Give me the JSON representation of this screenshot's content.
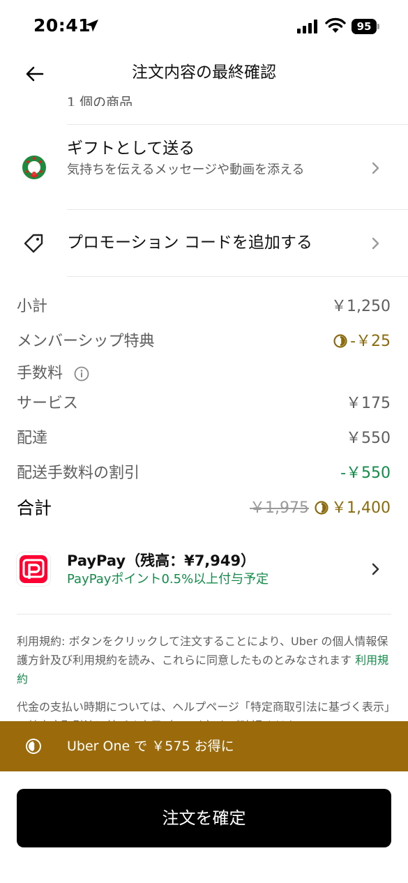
{
  "status_bar": {
    "time": "20:41",
    "battery": "95"
  },
  "header": {
    "title": "注文内容の最終確認"
  },
  "clipped_item": "1 個の商品",
  "gift": {
    "title": "ギフトとして送る",
    "subtitle": "気持ちを伝えるメッセージや動画を添える"
  },
  "promo": {
    "title": "プロモーション コードを追加する"
  },
  "prices": {
    "subtotal_label": "小計",
    "subtotal_value": "￥1,250",
    "membership_label": "メンバーシップ特典",
    "membership_value": "-￥25",
    "fees_label": "手数料",
    "service_label": "サービス",
    "service_value": "￥175",
    "delivery_label": "配達",
    "delivery_value": "￥550",
    "delivery_discount_label": "配送手数料の割引",
    "delivery_discount_value": "-￥550",
    "total_label": "合計",
    "total_original": "￥1,975",
    "total_value": "￥1,400"
  },
  "payment": {
    "title": "PayPay（残高：¥7,949）",
    "subtitle": "PayPayポイント0.5%以上付与予定"
  },
  "terms": {
    "text": "利用規約: ボタンをクリックして注文することにより、Uber の個人情報保護方針及び利用規約を読み、これらに同意したものとみなされます ",
    "link": "利用規約"
  },
  "legal_note": "代金の支払い時期については、ヘルプページ「特定商取引法に基づく表示」の特定商取引法に基づく表示（リンク）をご確認ください。",
  "banner": {
    "text": "Uber One で ￥575 お得に"
  },
  "confirm_button": "注文を確定",
  "colors": {
    "accent_gold": "#9b6a0a",
    "discount_green": "#138c4a"
  }
}
